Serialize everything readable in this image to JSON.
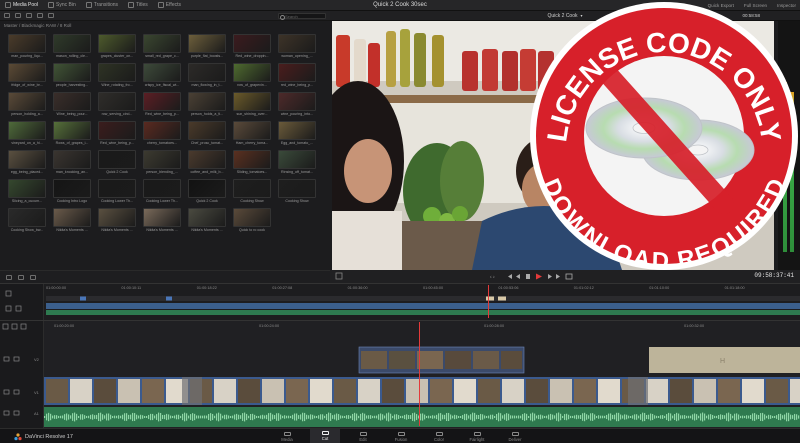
{
  "app": {
    "project_title": "Quick 2 Cook 30sec",
    "brand_name": "DaVinci Resolve 17"
  },
  "topbar": {
    "items": [
      {
        "label": "Media Pool",
        "active": true,
        "icon": "media-pool-icon"
      },
      {
        "label": "Sync Bin",
        "active": false,
        "icon": "sync-bin-icon"
      },
      {
        "label": "Transitions",
        "active": false,
        "icon": "transitions-icon"
      },
      {
        "label": "Titles",
        "active": false,
        "icon": "titles-icon"
      },
      {
        "label": "Effects",
        "active": false,
        "icon": "effects-icon"
      }
    ],
    "right_items": [
      "Quick Export",
      "Full Screen",
      "Inspector"
    ]
  },
  "media_pool": {
    "search_placeholder": "Search",
    "bin_path": "Master / Blackmagic RAW / 8 Roll",
    "clips": [
      {
        "label": "man_pouring_liqu...",
        "color": "#4a3b2a"
      },
      {
        "label": "mason_rolling_cle...",
        "color": "#2f3a2a"
      },
      {
        "label": "grapes_cluster_on...",
        "color": "#4d5a2c"
      },
      {
        "label": "small_red_grape_c...",
        "color": "#3a4630"
      },
      {
        "label": "purple_flat_boosts...",
        "color": "#6c5e3b"
      },
      {
        "label": "Red_wine_droppin...",
        "color": "#3b1b1e"
      },
      {
        "label": "woman_opening_...",
        "color": "#3d3328"
      },
      {
        "label": "fridge_of_wine_br...",
        "color": "#5b4a35"
      },
      {
        "label": "people_harvesting...",
        "color": "#415436"
      },
      {
        "label": "Wine_rotating_fro...",
        "color": "#2e3324"
      },
      {
        "label": "crispy_ice_fiscal_wi...",
        "color": "#3d4a3a"
      },
      {
        "label": "man_flowing_in_t...",
        "color": "#2c2a28"
      },
      {
        "label": "row_of_grapevin...",
        "color": "#4e6a2f"
      },
      {
        "label": "red_wine_being_p...",
        "color": "#4a1d1d"
      },
      {
        "label": "person_holding_a...",
        "color": "#5a4a38"
      },
      {
        "label": "Wine_being_pour...",
        "color": "#3a2e2a"
      },
      {
        "label": "row_serving_circl...",
        "color": "#2f2d2a"
      },
      {
        "label": "Red_wine_being_p...",
        "color": "#5b1e24"
      },
      {
        "label": "person_holds_a_ti...",
        "color": "#4a4034"
      },
      {
        "label": "sun_shining_over...",
        "color": "#6b5a2a"
      },
      {
        "label": "wine_pouring_into...",
        "color": "#4d2a2a"
      },
      {
        "label": "vineyard_on_a_hi...",
        "color": "#4f6a3a"
      },
      {
        "label": "Rows_of_grapes_i...",
        "color": "#56703a"
      },
      {
        "label": "Red_wine_being_p...",
        "color": "#3b1d1d"
      },
      {
        "label": "cherry_tomatoes...",
        "color": "#5a2a20"
      },
      {
        "label": "Chef_prosc_tomat...",
        "color": "#4a3a2a"
      },
      {
        "label": "Ham_cherry_toma...",
        "color": "#5a4a3a"
      },
      {
        "label": "Egg_and_tomato_...",
        "color": "#6a5a3a"
      },
      {
        "label": "egg_being_placed...",
        "color": "#5a5040"
      },
      {
        "label": "man_knocking_an...",
        "color": "#3a3530"
      },
      {
        "label": "Quick 2 Cook",
        "color": "#1a1a1a"
      },
      {
        "label": "person_blending_...",
        "color": "#3c3a30"
      },
      {
        "label": "coffee_and_milk_b...",
        "color": "#4a3a2d"
      },
      {
        "label": "Sliding_tomatoes...",
        "color": "#5a3020"
      },
      {
        "label": "Rinsing_off_tomat...",
        "color": "#3a4a3a"
      },
      {
        "label": "Slicing_a_cucum...",
        "color": "#35482e"
      },
      {
        "label": "Cooking Intro Logo",
        "color": "#151515"
      },
      {
        "label": "Cooking Lower Th...",
        "color": "#1a1a1a"
      },
      {
        "label": "Cooking Lower Th...",
        "color": "#1a1a1a"
      },
      {
        "label": "Quick 2 Cook",
        "color": "#121212"
      },
      {
        "label": "Cooking Show",
        "color": "#1e1e1e"
      },
      {
        "label": "Cooking Show",
        "color": "#1e1e1e"
      },
      {
        "label": "Cooking Show_bw...",
        "color": "#2a2a2a"
      },
      {
        "label": "Nikita's Moments ...",
        "color": "#6a5a4a"
      },
      {
        "label": "Nikita's Moments ...",
        "color": "#5a5040"
      },
      {
        "label": "Nikita's Moments ...",
        "color": "#7a6a5a"
      },
      {
        "label": "Nikita's Moments ...",
        "color": "#4a4a40"
      },
      {
        "label": "Quick to ro cook",
        "color": "#5a4a3a"
      }
    ]
  },
  "viewer": {
    "dropdown_label": "Quick 2 Cook",
    "timecode_top": "00:58:58",
    "timecode": "09:58:37:41"
  },
  "badge": {
    "line_top": "LICENSE CODE ONLY",
    "line_bottom": "DOWNLOAD REQUIRED",
    "ring_color": "#d7202a",
    "inner_color": "#f4f4f4"
  },
  "overview": {
    "ticks": [
      "01:00:00:00",
      "01:00:10:11",
      "01:00:18:22",
      "01:00:27:08",
      "01:00:36:00",
      "01:00:45:00",
      "01:00:53:06",
      "01:01:02:12",
      "01:01:10:00",
      "01:01:18:00"
    ]
  },
  "timeline": {
    "ticks": [
      "01:00:20:00",
      "01:00:24:00",
      "01:00:28:00",
      "01:00:32:00"
    ],
    "track_labels": [
      "V2",
      "V1",
      "A1"
    ]
  },
  "pages": {
    "tabs": [
      {
        "label": "Media",
        "active": false
      },
      {
        "label": "Cut",
        "active": true
      },
      {
        "label": "Edit",
        "active": false
      },
      {
        "label": "Fusion",
        "active": false
      },
      {
        "label": "Color",
        "active": false
      },
      {
        "label": "Fairlight",
        "active": false
      },
      {
        "label": "Deliver",
        "active": false
      }
    ]
  }
}
